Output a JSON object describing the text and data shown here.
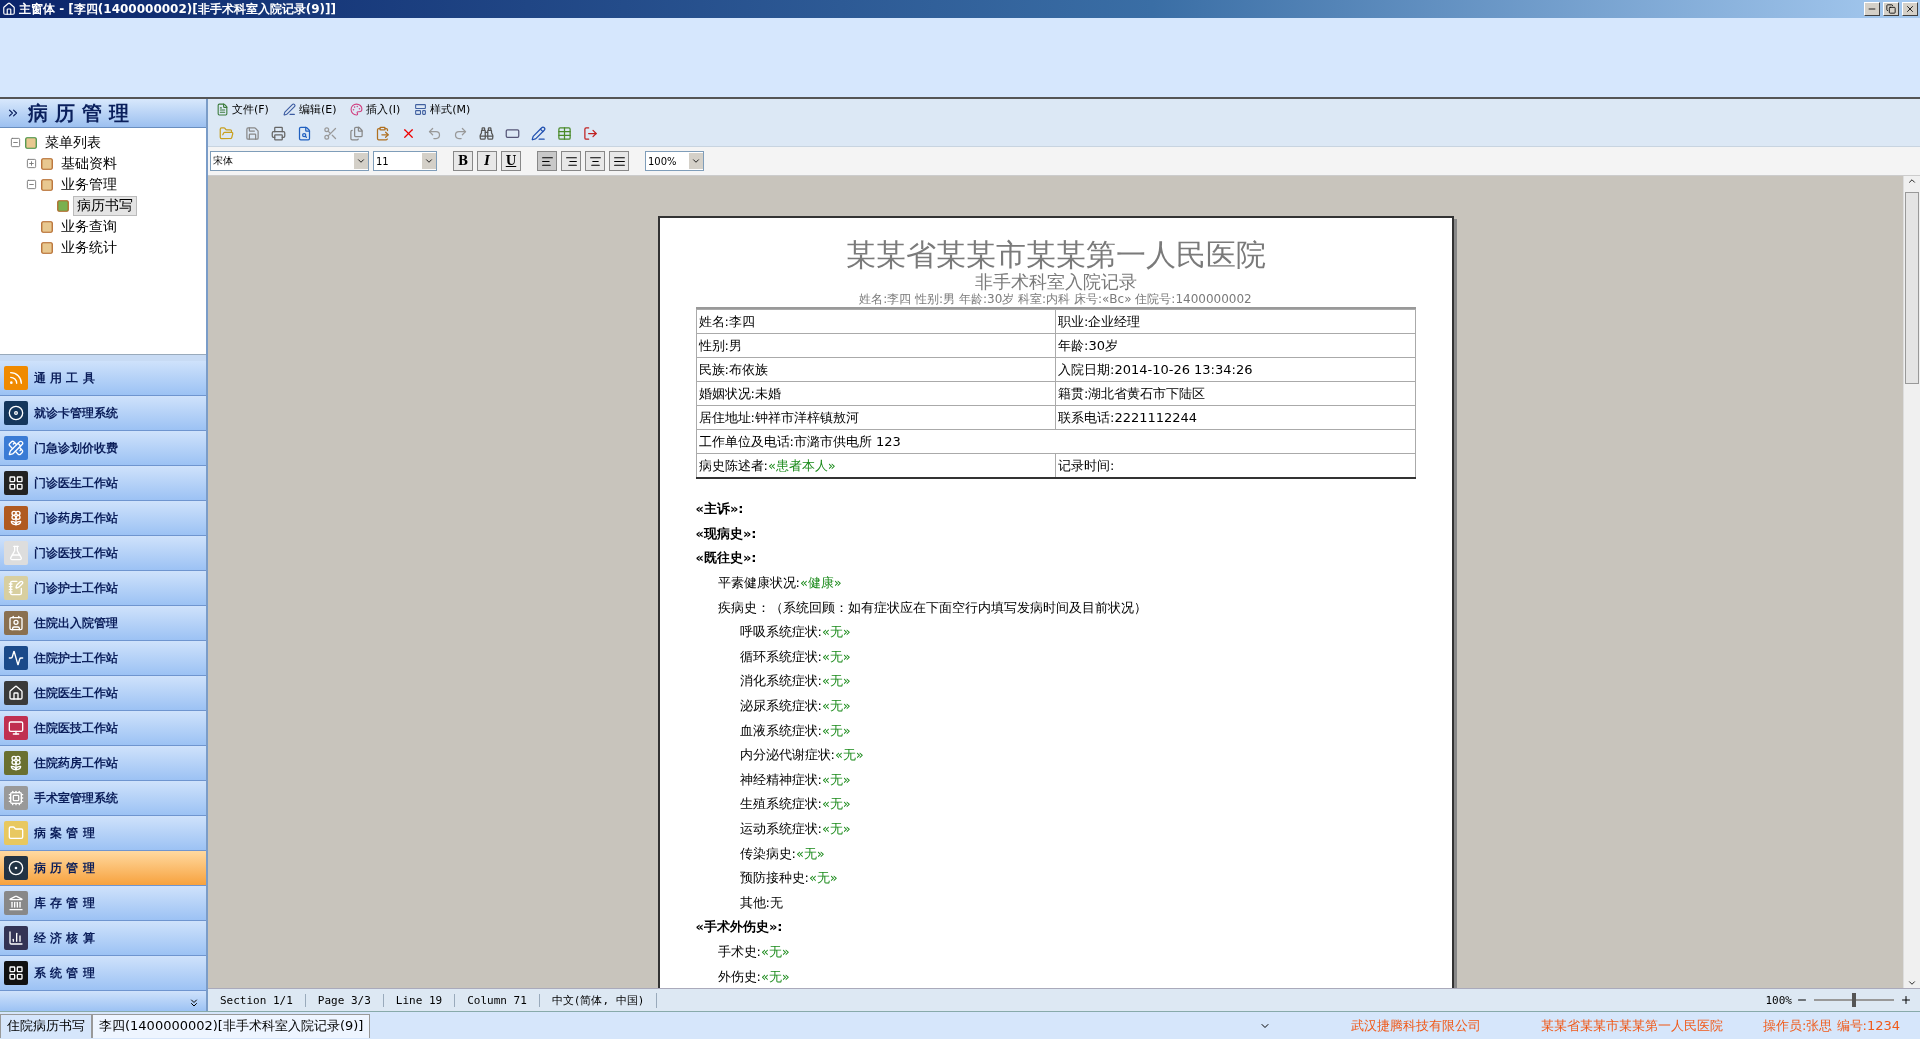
{
  "window": {
    "title": "主窗体 - [李四(1400000002)[非手术科室入院记录(9)]]"
  },
  "sidebar": {
    "title": "病 历 管 理",
    "tree": [
      {
        "label": "菜单列表",
        "expanded": true,
        "selected": false,
        "children": [
          {
            "label": "基础资料",
            "expanded": false,
            "selected": false
          },
          {
            "label": "业务管理",
            "expanded": true,
            "selected": false,
            "children": [
              {
                "label": "病历书写",
                "selected": true
              }
            ]
          },
          {
            "label": "业务查询",
            "selected": false
          },
          {
            "label": "业务统计",
            "selected": false
          }
        ]
      }
    ],
    "nav": [
      {
        "label": "通 用 工 具",
        "selected": false
      },
      {
        "label": "就诊卡管理系统",
        "selected": false
      },
      {
        "label": "门急诊划价收费",
        "selected": false
      },
      {
        "label": "门诊医生工作站",
        "selected": false
      },
      {
        "label": "门诊药房工作站",
        "selected": false
      },
      {
        "label": "门诊医技工作站",
        "selected": false
      },
      {
        "label": "门诊护士工作站",
        "selected": false
      },
      {
        "label": "住院出入院管理",
        "selected": false
      },
      {
        "label": "住院护士工作站",
        "selected": false
      },
      {
        "label": "住院医生工作站",
        "selected": false
      },
      {
        "label": "住院医技工作站",
        "selected": false
      },
      {
        "label": "住院药房工作站",
        "selected": false
      },
      {
        "label": "手术室管理系统",
        "selected": false
      },
      {
        "label": "病 案 管 理",
        "selected": false
      },
      {
        "label": "病 历 管 理",
        "selected": true
      },
      {
        "label": "库 存 管 理",
        "selected": false
      },
      {
        "label": "经 济 核 算",
        "selected": false
      },
      {
        "label": "系 统 管 理",
        "selected": false
      }
    ]
  },
  "menu": [
    "文件(F)",
    "编辑(E)",
    "插入(I)",
    "样式(M)"
  ],
  "format_bar": {
    "font": "宋体",
    "size": "11",
    "styles": [
      "B",
      "I",
      "U"
    ],
    "align": [
      {
        "selected": true
      },
      {
        "selected": false
      },
      {
        "selected": false
      },
      {
        "selected": false
      }
    ],
    "zoom": "100%"
  },
  "document": {
    "hospital": "某某省某某市某某第一人民医院",
    "title": "非手术科室入院记录",
    "info": "姓名:李四 性别:男 年龄:30岁 科室:内科 床号:«Bc» 住院号:1400000002",
    "table": [
      [
        {
          "label": "姓名:李四"
        },
        {
          "label": "职业:企业经理"
        }
      ],
      [
        {
          "label": "性别:男"
        },
        {
          "label": "年龄:30岁"
        }
      ],
      [
        {
          "label": "民族:布依族"
        },
        {
          "label": "入院日期:2014-10-26 13:34:26"
        }
      ],
      [
        {
          "label": "婚姻状况:未婚"
        },
        {
          "label": "籍贯:湖北省黄石市下陆区"
        }
      ],
      [
        {
          "label": "居住地址:钟祥市洋梓镇敖河"
        },
        {
          "label": "联系电话:2221112244"
        }
      ],
      [
        {
          "label": "工作单位及电话:市潞市供电所 123"
        }
      ],
      [
        {
          "label": "病史陈述者:",
          "field": "«患者本人»"
        },
        {
          "label": "记录时间:"
        }
      ]
    ],
    "sections": [
      {
        "label": "«主诉»:"
      },
      {
        "label": "«现病史»:"
      },
      {
        "label": "«既往史»:",
        "children": [
          {
            "label": "平素健康状况:",
            "field": "«健康»"
          },
          {
            "label": "疾病史：（系统回顾：如有症状应在下面空行内填写发病时间及目前状况）",
            "children": [
              {
                "label": "呼吸系统症状:",
                "field": "«无»"
              },
              {
                "label": "循环系统症状:",
                "field": "«无»"
              },
              {
                "label": "消化系统症状:",
                "field": "«无»"
              },
              {
                "label": "泌尿系统症状:",
                "field": "«无»"
              },
              {
                "label": "血液系统症状:",
                "field": "«无»"
              },
              {
                "label": "内分泌代谢症状:",
                "field": "«无»"
              },
              {
                "label": "神经精神症状:",
                "field": "«无»"
              },
              {
                "label": "生殖系统症状:",
                "field": "«无»"
              },
              {
                "label": "运动系统症状:",
                "field": "«无»"
              },
              {
                "label": "传染病史:",
                "field": "«无»"
              },
              {
                "label": "预防接种史:",
                "field": "«无»"
              },
              {
                "label": "其他:无"
              }
            ]
          }
        ]
      },
      {
        "label": "«手术外伤史»:",
        "children": [
          {
            "label": "手术史:",
            "field": "«无»"
          },
          {
            "label": "外伤史:",
            "field": "«无»"
          }
        ]
      }
    ]
  },
  "editor_status": {
    "items": [
      "Section 1/1",
      "Page 3/3",
      "Line 19",
      "Column 71",
      "中文(简体, 中国)"
    ],
    "zoom": "100%",
    "level": 0.5
  },
  "status_bar": {
    "tabs": [
      {
        "label": "住院病历书写",
        "selected": false
      },
      {
        "label": "李四(1400000002)[非手术科室入院记录(9)]",
        "selected": true
      }
    ],
    "company": "武汉捷腾科技有限公司",
    "hospital": "某某省某某市某某第一人民医院",
    "operator": "操作员:张思 编号:1234"
  }
}
